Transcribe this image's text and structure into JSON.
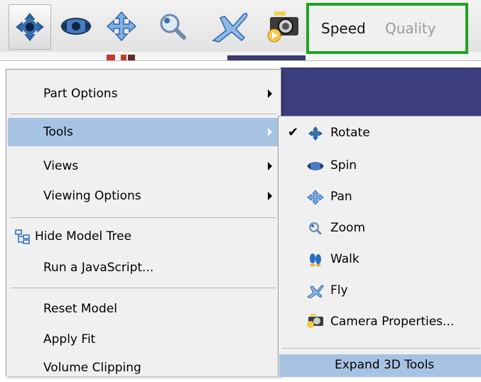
{
  "toolbar": {
    "tools": [
      {
        "name": "rotate-tool",
        "icon": "rotate-icon",
        "active": true
      },
      {
        "name": "spin-tool",
        "icon": "spin-icon"
      },
      {
        "name": "pan-tool",
        "icon": "pan-icon"
      },
      {
        "name": "zoom-tool",
        "icon": "zoom-icon"
      },
      {
        "name": "fly-tool",
        "icon": "fly-icon"
      },
      {
        "name": "camera-tool",
        "icon": "camera-icon"
      }
    ],
    "speed_label": "Speed",
    "quality_label": "Quality",
    "highlight_color": "#1fa51f"
  },
  "menu": {
    "part_options": "Part Options",
    "tools": "Tools",
    "views": "Views",
    "viewing_options": "Viewing Options",
    "hide_model_tree": "Hide Model Tree",
    "run_javascript": "Run a JavaScript...",
    "reset_model": "Reset Model",
    "apply_fit": "Apply Fit",
    "volume_clipping": "Volume Clipping",
    "highlight_color": "#a7c3e4"
  },
  "submenu": {
    "rotate": "Rotate",
    "spin": "Spin",
    "pan": "Pan",
    "zoom": "Zoom",
    "walk": "Walk",
    "fly": "Fly",
    "camera_properties": "Camera Properties...",
    "expand_3d_tools": "Expand 3D Tools",
    "checked_item": "Rotate"
  }
}
